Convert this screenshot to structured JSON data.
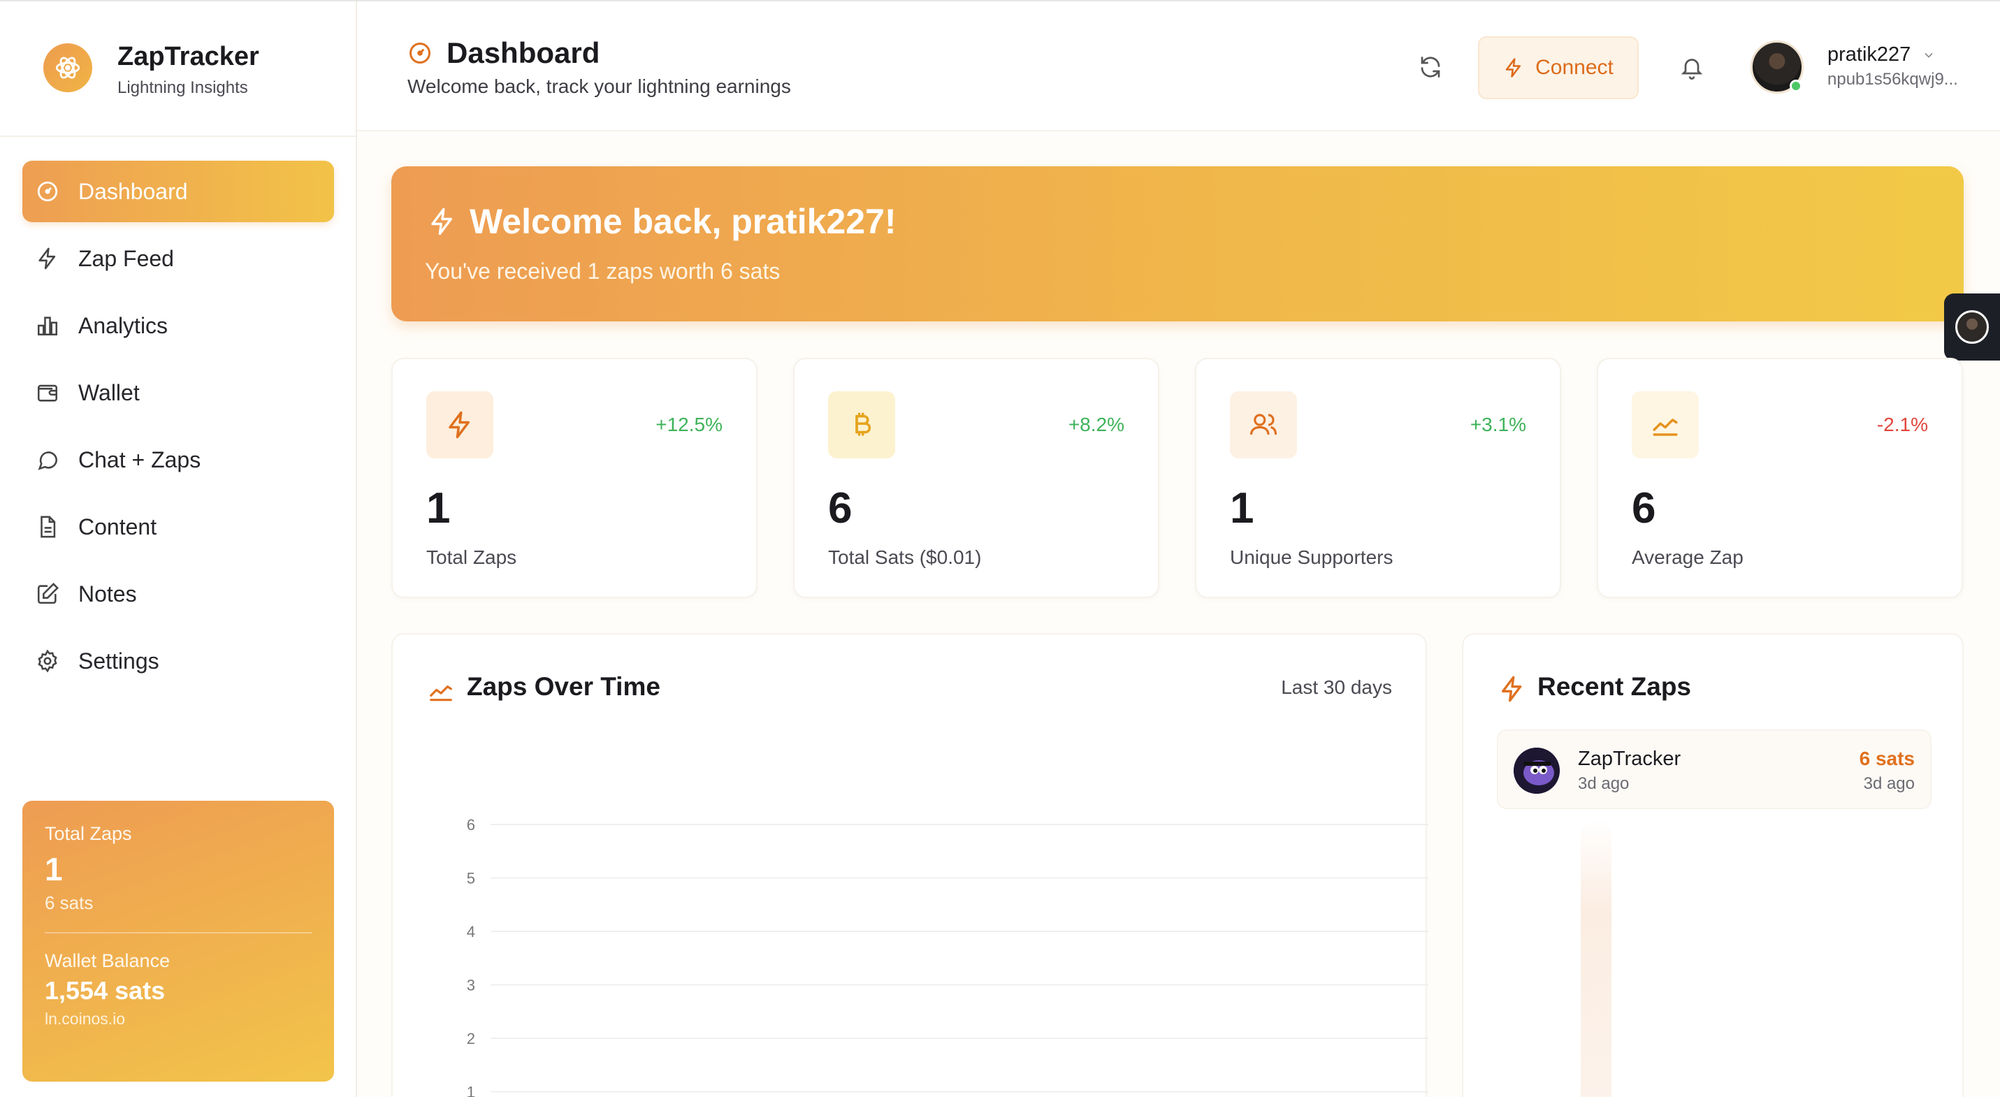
{
  "brand": {
    "title": "ZapTracker",
    "subtitle": "Lightning Insights"
  },
  "nav": [
    {
      "label": "Dashboard",
      "icon": "gauge-icon",
      "active": true
    },
    {
      "label": "Zap Feed",
      "icon": "bolt-icon",
      "active": false
    },
    {
      "label": "Analytics",
      "icon": "bar-chart-icon",
      "active": false
    },
    {
      "label": "Wallet",
      "icon": "wallet-icon",
      "active": false
    },
    {
      "label": "Chat + Zaps",
      "icon": "chat-icon",
      "active": false
    },
    {
      "label": "Content",
      "icon": "document-icon",
      "active": false
    },
    {
      "label": "Notes",
      "icon": "edit-icon",
      "active": false
    },
    {
      "label": "Settings",
      "icon": "gear-icon",
      "active": false
    }
  ],
  "sidebar_summary": {
    "total_zaps_label": "Total Zaps",
    "total_zaps_value": "1",
    "total_sats": "6 sats",
    "wallet_label": "Wallet Balance",
    "wallet_value": "1,554 sats",
    "wallet_provider": "ln.coinos.io"
  },
  "header": {
    "title": "Dashboard",
    "subtitle": "Welcome back, track your lightning earnings",
    "connect_label": "Connect",
    "user_name": "pratik227",
    "user_npub": "npub1s56kqwj9..."
  },
  "banner": {
    "title": "Welcome back, pratik227!",
    "subtitle": "You've received 1 zaps worth 6 sats"
  },
  "stats": [
    {
      "value": "1",
      "label": "Total Zaps",
      "change": "+12.5%",
      "trend": "up",
      "icon": "bolt-icon"
    },
    {
      "value": "6",
      "label": "Total Sats ($0.01)",
      "change": "+8.2%",
      "trend": "up",
      "icon": "bitcoin-icon"
    },
    {
      "value": "1",
      "label": "Unique Supporters",
      "change": "+3.1%",
      "trend": "up",
      "icon": "users-icon"
    },
    {
      "value": "6",
      "label": "Average Zap",
      "change": "-2.1%",
      "trend": "down",
      "icon": "trend-icon"
    }
  ],
  "zaps_chart": {
    "title": "Zaps Over Time",
    "range_label": "Last 30 days"
  },
  "chart_data": {
    "type": "bar",
    "title": "Zaps Over Time",
    "xlabel": "",
    "ylabel": "",
    "y_ticks": [
      6,
      5,
      4,
      3,
      2,
      1
    ],
    "ylim": [
      0,
      6
    ],
    "grid": true
  },
  "recent": {
    "title": "Recent Zaps",
    "items": [
      {
        "name": "ZapTracker",
        "time": "3d ago",
        "amount": "6 sats",
        "ago": "3d ago"
      }
    ]
  },
  "colors": {
    "accent": "#ee9c52",
    "accent_end": "#f2c348",
    "orange_text": "#dc6b1a",
    "positive": "#3fb35a",
    "negative": "#e0463c"
  }
}
